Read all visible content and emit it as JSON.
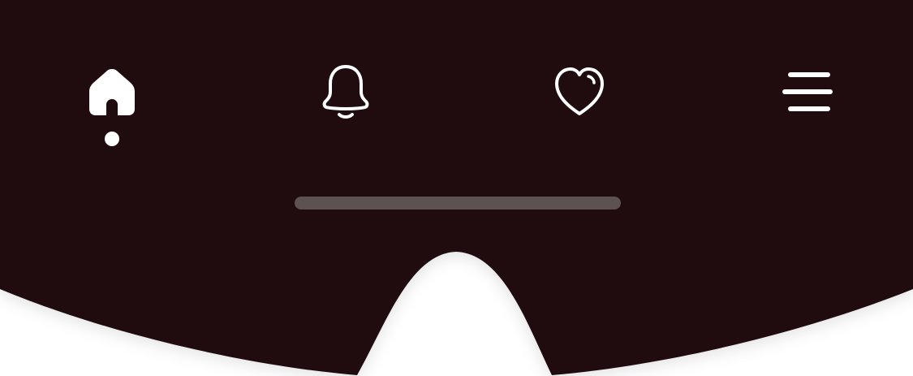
{
  "theme": {
    "bar_color": "#200c0e",
    "icon_color": "#ffffff",
    "indicator_color": "#5e5152",
    "background": "#ffffff"
  },
  "nav": {
    "items": [
      {
        "icon": "home-icon",
        "active": true
      },
      {
        "icon": "bell-icon",
        "active": false
      },
      {
        "icon": "heart-icon",
        "active": false
      },
      {
        "icon": "menu-icon",
        "active": false
      }
    ]
  }
}
